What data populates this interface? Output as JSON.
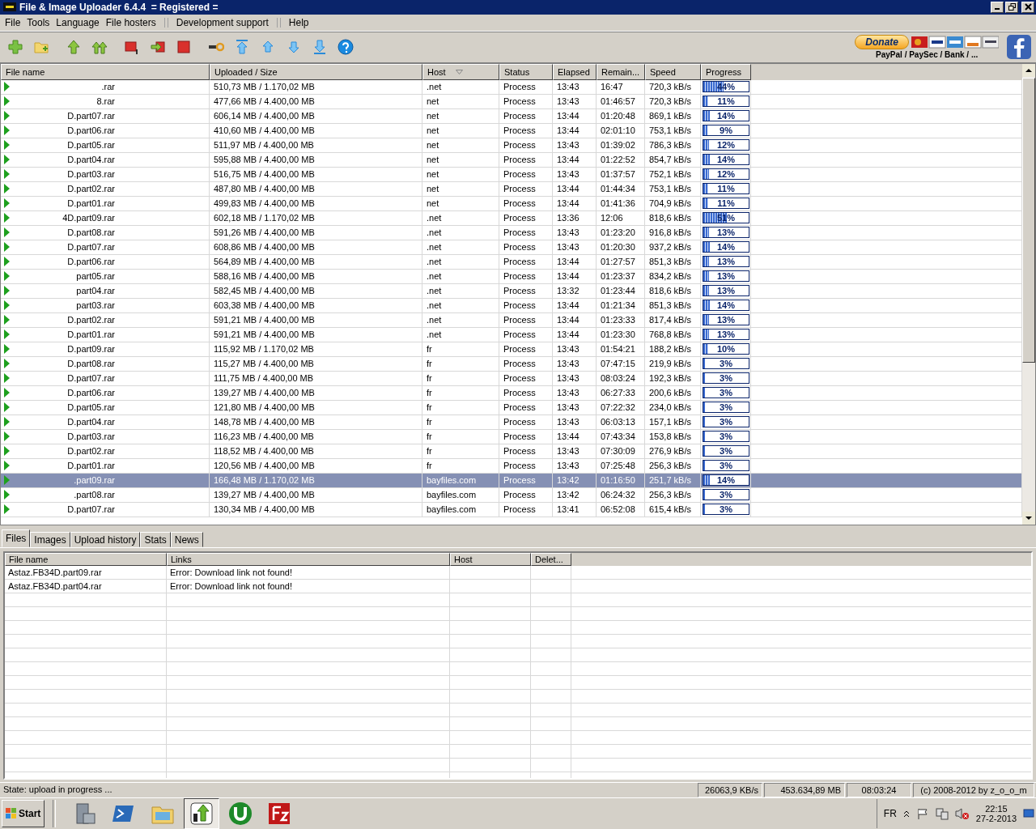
{
  "window": {
    "title": "File & Image Uploader 6.4.4  = Registered ="
  },
  "menu": [
    {
      "kind": "item",
      "label": "File"
    },
    {
      "kind": "item",
      "label": "Tools"
    },
    {
      "kind": "item",
      "label": "Language"
    },
    {
      "kind": "item",
      "label": "File hosters"
    },
    {
      "kind": "separator"
    },
    {
      "kind": "item",
      "label": "Development support"
    },
    {
      "kind": "separator"
    },
    {
      "kind": "item",
      "label": "Help"
    }
  ],
  "donate": {
    "button": "Donate",
    "caption": "PayPal / PaySec / Bank / ..."
  },
  "uploads": {
    "columns": [
      {
        "label": "File name",
        "sorted": false
      },
      {
        "label": "Uploaded / Size",
        "sorted": false
      },
      {
        "label": "Host",
        "sorted": true
      },
      {
        "label": "Status",
        "sorted": false
      },
      {
        "label": "Elapsed",
        "sorted": false
      },
      {
        "label": "Remain...",
        "sorted": false
      },
      {
        "label": "Speed",
        "sorted": false
      },
      {
        "label": "Progress",
        "sorted": false
      }
    ],
    "rows": [
      {
        "file": ".rar",
        "size": "510,73 MB / 1.170,02 MB",
        "host": ".net",
        "status": "Process",
        "elapsed": "13:43",
        "remaining": "16:47",
        "speed": "720,3 kB/s",
        "level": 0.44,
        "progress": "44%",
        "selected": false
      },
      {
        "file": "8.rar",
        "size": "477,66 MB / 4.400,00 MB",
        "host": "net",
        "status": "Process",
        "elapsed": "13:43",
        "remaining": "01:46:57",
        "speed": "720,3 kB/s",
        "level": 0.11,
        "progress": "11%",
        "selected": false
      },
      {
        "file": "D.part07.rar",
        "size": "606,14 MB / 4.400,00 MB",
        "host": "net",
        "status": "Process",
        "elapsed": "13:44",
        "remaining": "01:20:48",
        "speed": "869,1 kB/s",
        "level": 0.14,
        "progress": "14%",
        "selected": false
      },
      {
        "file": "D.part06.rar",
        "size": "410,60 MB / 4.400,00 MB",
        "host": "net",
        "status": "Process",
        "elapsed": "13:44",
        "remaining": "02:01:10",
        "speed": "753,1 kB/s",
        "level": 0.09,
        "progress": "9%",
        "selected": false
      },
      {
        "file": "D.part05.rar",
        "size": "511,97 MB / 4.400,00 MB",
        "host": "net",
        "status": "Process",
        "elapsed": "13:43",
        "remaining": "01:39:02",
        "speed": "786,3 kB/s",
        "level": 0.12,
        "progress": "12%",
        "selected": false
      },
      {
        "file": "D.part04.rar",
        "size": "595,88 MB / 4.400,00 MB",
        "host": "net",
        "status": "Process",
        "elapsed": "13:44",
        "remaining": "01:22:52",
        "speed": "854,7 kB/s",
        "level": 0.14,
        "progress": "14%",
        "selected": false
      },
      {
        "file": "D.part03.rar",
        "size": "516,75 MB / 4.400,00 MB",
        "host": "net",
        "status": "Process",
        "elapsed": "13:43",
        "remaining": "01:37:57",
        "speed": "752,1 kB/s",
        "level": 0.12,
        "progress": "12%",
        "selected": false
      },
      {
        "file": "D.part02.rar",
        "size": "487,80 MB / 4.400,00 MB",
        "host": "net",
        "status": "Process",
        "elapsed": "13:44",
        "remaining": "01:44:34",
        "speed": "753,1 kB/s",
        "level": 0.11,
        "progress": "11%",
        "selected": false
      },
      {
        "file": "D.part01.rar",
        "size": "499,83 MB / 4.400,00 MB",
        "host": "net",
        "status": "Process",
        "elapsed": "13:44",
        "remaining": "01:41:36",
        "speed": "704,9 kB/s",
        "level": 0.11,
        "progress": "11%",
        "selected": false
      },
      {
        "file": "4D.part09.rar",
        "size": "602,18 MB / 1.170,02 MB",
        "host": ".net",
        "status": "Process",
        "elapsed": "13:36",
        "remaining": "12:06",
        "speed": "818,6 kB/s",
        "level": 0.51,
        "progress": "51%",
        "selected": false
      },
      {
        "file": "D.part08.rar",
        "size": "591,26 MB / 4.400,00 MB",
        "host": ".net",
        "status": "Process",
        "elapsed": "13:43",
        "remaining": "01:23:20",
        "speed": "916,8 kB/s",
        "level": 0.13,
        "progress": "13%",
        "selected": false
      },
      {
        "file": "D.part07.rar",
        "size": "608,86 MB / 4.400,00 MB",
        "host": ".net",
        "status": "Process",
        "elapsed": "13:43",
        "remaining": "01:20:30",
        "speed": "937,2 kB/s",
        "level": 0.14,
        "progress": "14%",
        "selected": false
      },
      {
        "file": "D.part06.rar",
        "size": "564,89 MB / 4.400,00 MB",
        "host": ".net",
        "status": "Process",
        "elapsed": "13:44",
        "remaining": "01:27:57",
        "speed": "851,3 kB/s",
        "level": 0.13,
        "progress": "13%",
        "selected": false
      },
      {
        "file": "part05.rar",
        "size": "588,16 MB / 4.400,00 MB",
        "host": ".net",
        "status": "Process",
        "elapsed": "13:44",
        "remaining": "01:23:37",
        "speed": "834,2 kB/s",
        "level": 0.13,
        "progress": "13%",
        "selected": false
      },
      {
        "file": "part04.rar",
        "size": "582,45 MB / 4.400,00 MB",
        "host": ".net",
        "status": "Process",
        "elapsed": "13:32",
        "remaining": "01:23:44",
        "speed": "818,6 kB/s",
        "level": 0.13,
        "progress": "13%",
        "selected": false
      },
      {
        "file": "part03.rar",
        "size": "603,38 MB / 4.400,00 MB",
        "host": ".net",
        "status": "Process",
        "elapsed": "13:44",
        "remaining": "01:21:34",
        "speed": "851,3 kB/s",
        "level": 0.14,
        "progress": "14%",
        "selected": false
      },
      {
        "file": "D.part02.rar",
        "size": "591,21 MB / 4.400,00 MB",
        "host": ".net",
        "status": "Process",
        "elapsed": "13:44",
        "remaining": "01:23:33",
        "speed": "817,4 kB/s",
        "level": 0.13,
        "progress": "13%",
        "selected": false
      },
      {
        "file": "D.part01.rar",
        "size": "591,21 MB / 4.400,00 MB",
        "host": ".net",
        "status": "Process",
        "elapsed": "13:44",
        "remaining": "01:23:30",
        "speed": "768,8 kB/s",
        "level": 0.13,
        "progress": "13%",
        "selected": false
      },
      {
        "file": "D.part09.rar",
        "size": "115,92 MB / 1.170,02 MB",
        "host": "fr",
        "status": "Process",
        "elapsed": "13:43",
        "remaining": "01:54:21",
        "speed": "188,2 kB/s",
        "level": 0.1,
        "progress": "10%",
        "selected": false
      },
      {
        "file": "D.part08.rar",
        "size": "115,27 MB / 4.400,00 MB",
        "host": "fr",
        "status": "Process",
        "elapsed": "13:43",
        "remaining": "07:47:15",
        "speed": "219,9 kB/s",
        "level": 0.03,
        "progress": "3%",
        "selected": false
      },
      {
        "file": "D.part07.rar",
        "size": "111,75 MB / 4.400,00 MB",
        "host": "fr",
        "status": "Process",
        "elapsed": "13:43",
        "remaining": "08:03:24",
        "speed": "192,3 kB/s",
        "level": 0.03,
        "progress": "3%",
        "selected": false
      },
      {
        "file": "D.part06.rar",
        "size": "139,27 MB / 4.400,00 MB",
        "host": "fr",
        "status": "Process",
        "elapsed": "13:43",
        "remaining": "06:27:33",
        "speed": "200,6 kB/s",
        "level": 0.03,
        "progress": "3%",
        "selected": false
      },
      {
        "file": "D.part05.rar",
        "size": "121,80 MB / 4.400,00 MB",
        "host": "fr",
        "status": "Process",
        "elapsed": "13:43",
        "remaining": "07:22:32",
        "speed": "234,0 kB/s",
        "level": 0.03,
        "progress": "3%",
        "selected": false
      },
      {
        "file": "D.part04.rar",
        "size": "148,78 MB / 4.400,00 MB",
        "host": "fr",
        "status": "Process",
        "elapsed": "13:43",
        "remaining": "06:03:13",
        "speed": "157,1 kB/s",
        "level": 0.03,
        "progress": "3%",
        "selected": false
      },
      {
        "file": "D.part03.rar",
        "size": "116,23 MB / 4.400,00 MB",
        "host": "fr",
        "status": "Process",
        "elapsed": "13:44",
        "remaining": "07:43:34",
        "speed": "153,8 kB/s",
        "level": 0.03,
        "progress": "3%",
        "selected": false
      },
      {
        "file": "D.part02.rar",
        "size": "118,52 MB / 4.400,00 MB",
        "host": "fr",
        "status": "Process",
        "elapsed": "13:43",
        "remaining": "07:30:09",
        "speed": "276,9 kB/s",
        "level": 0.03,
        "progress": "3%",
        "selected": false
      },
      {
        "file": "D.part01.rar",
        "size": "120,56 MB / 4.400,00 MB",
        "host": "fr",
        "status": "Process",
        "elapsed": "13:43",
        "remaining": "07:25:48",
        "speed": "256,3 kB/s",
        "level": 0.03,
        "progress": "3%",
        "selected": false
      },
      {
        "file": ".part09.rar",
        "size": "166,48 MB / 1.170,02 MB",
        "host": "bayfiles.com",
        "status": "Process",
        "elapsed": "13:42",
        "remaining": "01:16:50",
        "speed": "251,7 kB/s",
        "level": 0.14,
        "progress": "14%",
        "selected": true
      },
      {
        "file": ".part08.rar",
        "size": "139,27 MB / 4.400,00 MB",
        "host": "bayfiles.com",
        "status": "Process",
        "elapsed": "13:42",
        "remaining": "06:24:32",
        "speed": "256,3 kB/s",
        "level": 0.03,
        "progress": "3%",
        "selected": false
      },
      {
        "file": "D.part07.rar",
        "size": "130,34 MB / 4.400,00 MB",
        "host": "bayfiles.com",
        "status": "Process",
        "elapsed": "13:41",
        "remaining": "06:52:08",
        "speed": "615,4 kB/s",
        "level": 0.03,
        "progress": "3%",
        "selected": false
      }
    ]
  },
  "tabs": [
    {
      "label": "Files",
      "selected": true
    },
    {
      "label": "Images",
      "selected": false
    },
    {
      "label": "Upload history",
      "selected": false
    },
    {
      "label": "Stats",
      "selected": false
    },
    {
      "label": "News",
      "selected": false
    }
  ],
  "files": {
    "columns": [
      "File name",
      "Links",
      "Host",
      "Delet..."
    ],
    "rows": [
      {
        "file": "Astaz.FB34D.part09.rar",
        "links": "Error: Download link not found!"
      },
      {
        "file": "Astaz.FB34D.part04.rar",
        "links": "Error: Download link not found!"
      }
    ]
  },
  "status_bar": [
    "State: upload in progress ...",
    "26063,9 KB/s",
    "453.634,89 MB",
    "08:03:24",
    "(c) 2008-2012 by z_o_o_m"
  ],
  "taskbar": {
    "start": "Start",
    "apps": [
      {
        "kind": "server",
        "active": false
      },
      {
        "kind": "powershell",
        "active": false
      },
      {
        "kind": "explorer",
        "active": false
      },
      {
        "kind": "uploader",
        "active": true
      },
      {
        "kind": "torrent",
        "active": false
      },
      {
        "kind": "ftp",
        "active": false
      }
    ],
    "language": "FR",
    "time": "22:15",
    "date": "27-2-2013"
  }
}
